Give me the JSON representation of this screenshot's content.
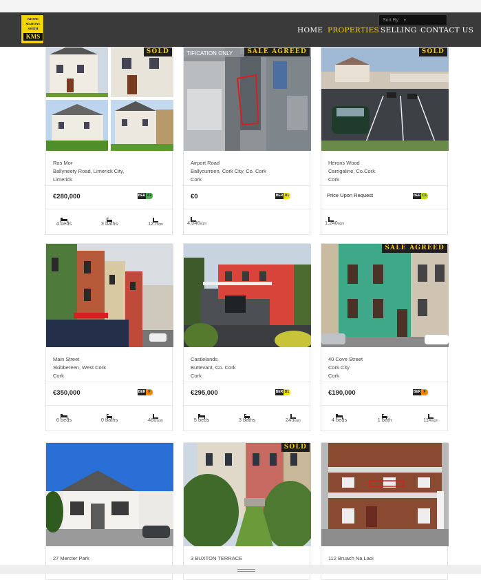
{
  "header": {
    "logo": {
      "lines": [
        "KEANE",
        "MAHONY",
        "SMITH"
      ],
      "abbr": "KMS"
    },
    "sort_label": "Sort By:",
    "nav": [
      {
        "label": "HOME",
        "active": false
      },
      {
        "label": "PROPERTIES",
        "active": true
      },
      {
        "label": "SELLING",
        "active": false
      },
      {
        "label": "CONTACT US",
        "active": false
      }
    ]
  },
  "colors": {
    "header_bg": "#3a3a3a",
    "nav_active": "#f5d300",
    "badge_text": "#f5c518",
    "badge_bg": "#1e1e1e"
  },
  "listings": [
    {
      "badge": "SOLD",
      "line1": "Ros Mor",
      "line2": "Ballyneety Road, Limerick City,",
      "line3": "Limerick",
      "price": "€280,000",
      "ber": "A2",
      "ber_color": "#4caf50",
      "beds": "4 beds",
      "baths": "3 baths",
      "area": "127",
      "unit": "sqm",
      "photo": "houses-grid"
    },
    {
      "badge": "SALE AGREED",
      "line1": "Airport Road",
      "line2": "Ballycurreen, Cork City, Co. Cork",
      "line3": "Cork",
      "price": "€0",
      "ber": "D1",
      "ber_color": "#f2e600",
      "beds": "",
      "baths": "",
      "area": "4,046",
      "unit": "sqm",
      "photo_text": "TIFICATION ONLY",
      "photo": "aerial"
    },
    {
      "badge": "SOLD",
      "line1": "Herons Wood",
      "line2": "Carrigaline, Co.Cork",
      "line3": "Cork",
      "price": "Price Upon Request",
      "ber": "C1",
      "ber_color": "#c5e000",
      "beds": "",
      "baths": "",
      "area": "1,240",
      "unit": "sqm",
      "photo": "carpark"
    },
    {
      "badge": "",
      "line1": "Main Street",
      "line2": "Skibbereen, West Cork",
      "line3": "Cork",
      "price": "€350,000",
      "ber": "F",
      "ber_color": "#f08a00",
      "beds": "6 beds",
      "baths": "0 baths",
      "area": "460",
      "unit": "sqm",
      "photo": "street"
    },
    {
      "badge": "",
      "line1": "Castlelands",
      "line2": "Buttevant, Co. Cork",
      "line3": "Cork",
      "price": "€295,000",
      "ber": "D1",
      "ber_color": "#f2e600",
      "beds": "5 beds",
      "baths": "3 baths",
      "area": "243",
      "unit": "sqm",
      "photo": "redhouse"
    },
    {
      "badge": "SALE AGREED",
      "line1": "40 Cove Street",
      "line2": "Cork City",
      "line3": "Cork",
      "price": "€190,000",
      "ber": "F",
      "ber_color": "#f08a00",
      "beds": "4 beds",
      "baths": "1 bath",
      "area": "114",
      "unit": "sqm",
      "photo": "greenhouse"
    },
    {
      "badge": "",
      "line1": "27 Mercier Park",
      "line2": "",
      "line3": "",
      "price": "",
      "ber": "",
      "beds": "",
      "baths": "",
      "area": "",
      "unit": "",
      "photo": "bungalow"
    },
    {
      "badge": "SOLD",
      "line1": "3 BUXTON TERRACE",
      "line2": "",
      "line3": "",
      "price": "",
      "ber": "",
      "beds": "",
      "baths": "",
      "area": "",
      "unit": "",
      "photo": "terrace"
    },
    {
      "badge": "",
      "line1": "112 Bruach Na Laoi",
      "line2": "",
      "line3": "",
      "price": "",
      "ber": "",
      "beds": "",
      "baths": "",
      "area": "",
      "unit": "",
      "photo": "apartments"
    }
  ]
}
